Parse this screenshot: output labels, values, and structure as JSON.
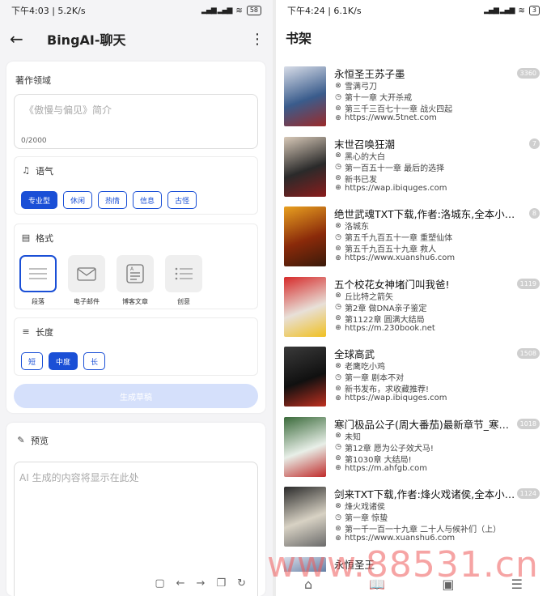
{
  "left": {
    "status": {
      "time_speed": "下午4:03 | 5.2K/s",
      "battery": "58"
    },
    "appbar": {
      "title": "BingAI-聊天"
    },
    "domain": {
      "label": "著作领域",
      "placeholder": "《傲慢与偏见》简介",
      "counter": "0/2000"
    },
    "tone": {
      "label": "语气",
      "options": [
        "专业型",
        "休闲",
        "热情",
        "信息",
        "古怪"
      ],
      "selected": "专业型"
    },
    "format": {
      "label": "格式",
      "options": [
        "段落",
        "电子邮件",
        "博客文章",
        "创意"
      ],
      "selected": "段落"
    },
    "length": {
      "label": "长度",
      "options": [
        "短",
        "中度",
        "长"
      ],
      "selected": "中度"
    },
    "generate_label": "生成草稿",
    "preview": {
      "label": "预览",
      "placeholder": "AI 生成的内容将显示在此处"
    }
  },
  "right": {
    "status": {
      "time_speed": "下午4:24 | 6.1K/s",
      "battery": "3"
    },
    "title": "书架",
    "books": [
      {
        "title": "永恒圣王苏子墨",
        "author": "雪满弓刀",
        "chapter": "第十一章 大开杀戒",
        "latest": "第三千三百七十一章 战火四起",
        "url": "https://www.5tnet.com",
        "badge": "3360",
        "colors": [
          "#3a5c8c",
          "#d8dde8",
          "#9b2a2a"
        ]
      },
      {
        "title": "末世召唤狂潮",
        "author": "黑心的大白",
        "chapter": "第一百五十一章 最后的选择",
        "latest": "新书已发",
        "url": "https://wap.ibiquges.com",
        "badge": "7",
        "colors": [
          "#2a2a2a",
          "#d8c9b8",
          "#8a1c1c"
        ]
      },
      {
        "title": "绝世武魂TXT下载,作者:洛城东,全本小说网",
        "author": "洛城东",
        "chapter": "第五千九百五十一章 重塑仙体",
        "latest": "第五千九百五十九章 救人",
        "url": "https://www.xuanshu6.com",
        "badge": "8",
        "colors": [
          "#8a2a0a",
          "#e8a020",
          "#3a1a0a"
        ]
      },
      {
        "title": "五个校花女神堵门叫我爸!",
        "author": "丘比特之箭矢",
        "chapter": "第2章 做DNA亲子鉴定",
        "latest": "第1122章 圆满大结局",
        "url": "https://m.230book.net",
        "badge": "1119",
        "colors": [
          "#e8e0d8",
          "#d62a2a",
          "#f0c020"
        ]
      },
      {
        "title": "全球高武",
        "author": "老鹰吃小鸡",
        "chapter": "第一章 剧本不对",
        "latest": "新书发布，求收藏推荐!",
        "url": "https://wap.ibiquges.com",
        "badge": "1508",
        "colors": [
          "#101010",
          "#3a3a3a",
          "#c03020"
        ]
      },
      {
        "title": "寒门极品公子(周大番茄)最新章节_寒门极品公子全文",
        "author": "未知",
        "chapter": "第12章 愿为公子效犬马!",
        "latest": "第1030章 大结局!",
        "url": "https://m.ahfgb.com",
        "badge": "1018",
        "colors": [
          "#e8efe8",
          "#3a6a3a",
          "#c02a2a"
        ]
      },
      {
        "title": "剑来TXT下载,作者:烽火戏诸侯,全本小说网",
        "author": "烽火戏诸侯",
        "chapter": "第一章 惊蛰",
        "latest": "第一千一百一十九章 二十人与候补们（上）",
        "url": "https://www.xuanshu6.com",
        "badge": "1124",
        "colors": [
          "#d8d2c4",
          "#2a2a2a",
          "#6a6a6a"
        ]
      },
      {
        "title": "永恒圣王",
        "author": "",
        "chapter": "",
        "latest": "",
        "url": "",
        "badge": "",
        "colors": [
          "#3a5c8c",
          "#d8dde8",
          "#9b2a2a"
        ]
      }
    ]
  },
  "watermark": "www.88531.cn"
}
